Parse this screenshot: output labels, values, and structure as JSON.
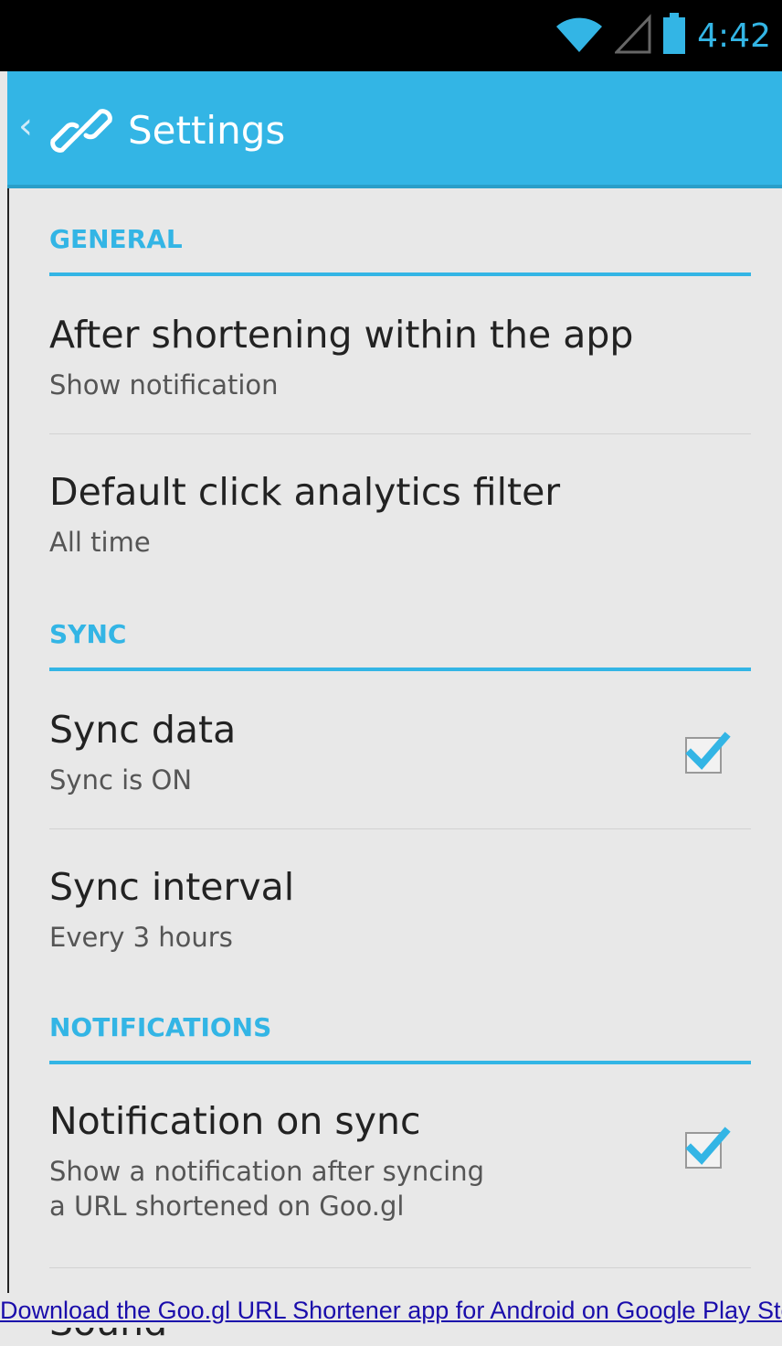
{
  "status_bar": {
    "time": "4:42",
    "icons": [
      "wifi-icon",
      "signal-icon",
      "battery-icon"
    ]
  },
  "action_bar": {
    "up_icon": "chevron-left-icon",
    "app_icon": "link-icon",
    "title": "Settings"
  },
  "sections": {
    "general": {
      "header": "GENERAL",
      "prefs": [
        {
          "title": "After shortening within the app",
          "summary": "Show notification"
        },
        {
          "title": "Default click analytics filter",
          "summary": "All time"
        }
      ]
    },
    "sync": {
      "header": "SYNC",
      "prefs": [
        {
          "title": "Sync data",
          "summary": "Sync is ON",
          "checked": true
        },
        {
          "title": "Sync interval",
          "summary": "Every 3 hours"
        }
      ]
    },
    "notifications": {
      "header": "NOTIFICATIONS",
      "prefs": [
        {
          "title": "Notification on sync",
          "summary": "Show a notification after syncing\na URL shortened on Goo.gl",
          "checked": true
        },
        {
          "title": "Sound",
          "summary": ""
        }
      ]
    }
  },
  "footer": {
    "text": "Download the Goo.gl URL Shortener app for Android on Google Play Store"
  },
  "colors": {
    "accent": "#33b5e5",
    "background": "#e8e8e8"
  }
}
